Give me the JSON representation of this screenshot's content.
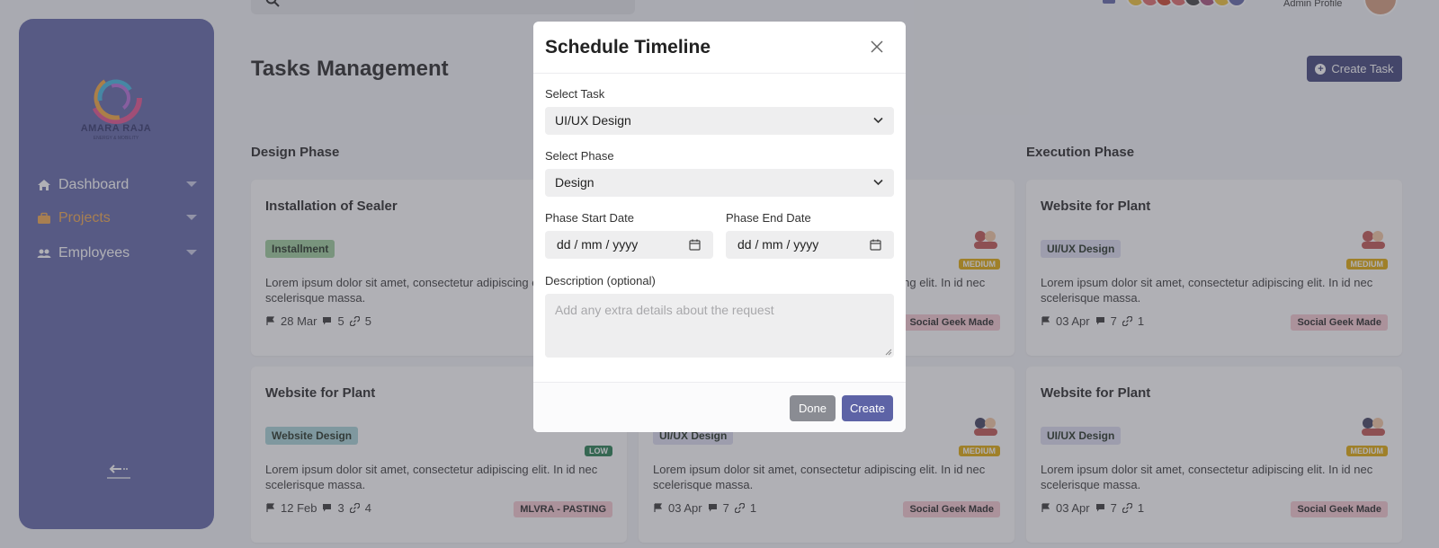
{
  "brand": {
    "name": "AMARA RAJA",
    "tagline": "ENERGY & MOBILITY"
  },
  "sidebar": {
    "items": [
      {
        "label": "Dashboard",
        "icon": "home-icon"
      },
      {
        "label": "Projects",
        "icon": "briefcase-icon",
        "active": true
      },
      {
        "label": "Employees",
        "icon": "users-icon"
      }
    ],
    "collapse_icon": "arrow-left-icon"
  },
  "topbar": {
    "search_placeholder": "Search",
    "admin_label": "Admin Profile"
  },
  "page": {
    "title": "Tasks Management",
    "create_task_label": "Create Task"
  },
  "columns": [
    "Design Phase",
    "Execution Phase"
  ],
  "cards": [
    {
      "title": "Installation of Sealer",
      "tag": "Installment",
      "desc": "Lorem ipsum dolor sit amet, consectetur adipiscing elit. In id nec scelerisque massa.",
      "date": "28 Mar",
      "comments": "5",
      "links": "5"
    },
    {
      "title": "",
      "desc": "Lorem ipsum dolor sit amet, consectetur adipiscing elit. In id nec scelerisque massa.",
      "priority": "MEDIUM",
      "client": "Social Geek Made"
    },
    {
      "title": "Website for Plant",
      "tag": "UI/UX Design",
      "desc": "Lorem ipsum dolor sit amet, consectetur adipiscing elit. In id nec scelerisque massa.",
      "date": "03 Apr",
      "comments": "7",
      "links": "1",
      "priority": "MEDIUM",
      "client": "Social Geek Made"
    },
    {
      "title": "Website for Plant",
      "tag": "Website Design",
      "desc": "Lorem ipsum dolor sit amet, consectetur adipiscing elit. In id nec scelerisque massa.",
      "date": "12 Feb",
      "comments": "3",
      "links": "4",
      "priority": "LOW",
      "client": "MLVRA - PASTING"
    },
    {
      "title": "",
      "tag": "UI/UX Design",
      "desc": "Lorem ipsum dolor sit amet, consectetur adipiscing elit. In id nec scelerisque massa.",
      "date": "03 Apr",
      "comments": "7",
      "links": "1",
      "priority": "MEDIUM",
      "client": "Social Geek Made"
    },
    {
      "title": "Website for Plant",
      "tag": "UI/UX Design",
      "desc": "Lorem ipsum dolor sit amet, consectetur adipiscing elit. In id nec scelerisque massa.",
      "date": "03 Apr",
      "comments": "7",
      "links": "1",
      "priority": "MEDIUM",
      "client": "Social Geek Made"
    }
  ],
  "modal": {
    "title": "Schedule Timeline",
    "select_task_label": "Select Task",
    "select_task_value": "UI/UX Design",
    "select_phase_label": "Select Phase",
    "select_phase_value": "Design",
    "start_date_label": "Phase Start Date",
    "end_date_label": "Phase End Date",
    "date_placeholder": "dd / mm / yyyy",
    "description_label": "Description (optional)",
    "description_placeholder": "Add any extra details about the request",
    "done_label": "Done",
    "create_label": "Create"
  },
  "colors": {
    "sidebar": "#5d63a6",
    "accent": "#f0a64a",
    "primary_dark": "#3b3f77",
    "tag_installment": "#9ccc9a",
    "tag_website": "#a6d3d8",
    "tag_uiux": "#dcdcf0",
    "priority_medium": "#e0a800",
    "priority_low": "#1f7a4c",
    "client_badge": "#f6c9cf"
  }
}
